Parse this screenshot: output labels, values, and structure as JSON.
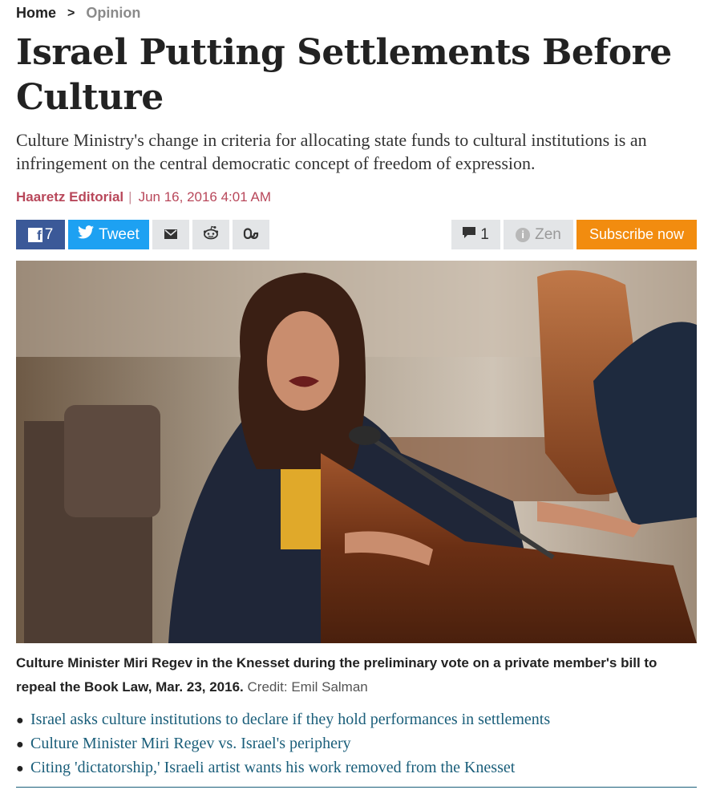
{
  "breadcrumb": {
    "home": "Home",
    "separator": ">",
    "section": "Opinion"
  },
  "article": {
    "title": "Israel Putting Settlements Before Culture",
    "subtitle": "Culture Ministry's change in criteria for allocating state funds to cultural institutions is an infringement on the central democratic concept of freedom of expression.",
    "author": "Haaretz Editorial",
    "byline_separator": "|",
    "date": "Jun 16, 2016 4:01 AM"
  },
  "share": {
    "facebook_icon_letter": "f",
    "facebook_count": "7",
    "tweet_label": "Tweet",
    "comment_count": "1",
    "zen_label": "Zen",
    "subscribe_label": "Subscribe now"
  },
  "icons": {
    "facebook": "facebook-icon",
    "twitter": "twitter-icon",
    "mail": "mail-icon",
    "reddit": "reddit-icon",
    "stumbleupon": "stumbleupon-icon",
    "comment": "comment-icon",
    "zen": "zen-icon"
  },
  "photo": {
    "caption": "Culture Minister Miri Regev in the Knesset during the preliminary vote on a private member's bill to repeal the Book Law, Mar. 23, 2016.",
    "credit_label": "Credit:",
    "credit_name": "Emil Salman"
  },
  "related": [
    {
      "label": "Israel asks culture institutions to declare if they hold performances in settlements"
    },
    {
      "label": "Culture Minister Miri Regev vs. Israel's periphery"
    },
    {
      "label": "Citing 'dictatorship,' Israeli artist wants his work removed from the Knesset"
    }
  ],
  "colors": {
    "facebook": "#3b5998",
    "twitter": "#1da1f2",
    "subscribe": "#f28c0f",
    "byline": "#b8475a",
    "link": "#1a5e7a"
  }
}
